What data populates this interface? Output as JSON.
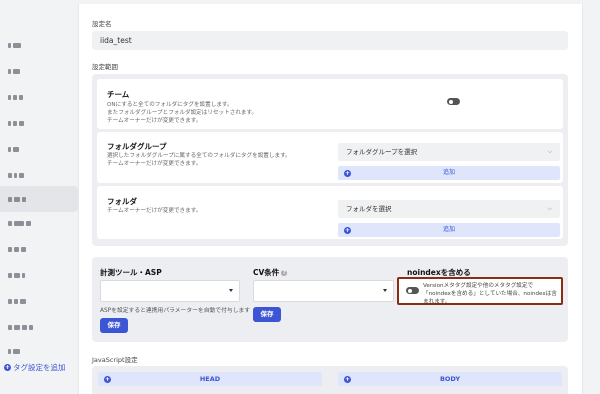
{
  "sidebar": {
    "add_label": "タグ設定を追加"
  },
  "form": {
    "name_label": "設定名",
    "name_value": "iida_test",
    "scope_label": "設定範囲",
    "team": {
      "title": "チーム",
      "desc": [
        "ONにすると全てのフォルダにタグを設置します。",
        "またフォルダグループとフォルダ設定はリセットされます。",
        "チームオーナーだけが変更できます。"
      ]
    },
    "folder_group": {
      "title": "フォルダグループ",
      "desc": [
        "選択したフォルダグループに属する全てのフォルダにタグを設置します。",
        "チームオーナーだけが変更できます。"
      ],
      "select_placeholder": "フォルダグループを選択",
      "add_label": "追加"
    },
    "folder": {
      "title": "フォルダ",
      "desc": [
        "チームオーナーだけが変更できます。"
      ],
      "select_placeholder": "フォルダを選択",
      "add_label": "追加"
    },
    "tool": {
      "title": "計測ツール・ASP",
      "note": "ASPを設定すると連携用パラメーターを自動で付与します",
      "save_label": "保存"
    },
    "cv": {
      "title": "CV条件",
      "help": "?",
      "save_label": "保存"
    },
    "noindex": {
      "title": "noindexを含める",
      "text": "Versionメタタグ設定や他のメタタグ設定で「noindexを含める」としていた場合、noindexは含まれます。"
    },
    "js": {
      "label": "JavaScript設定",
      "head_label": "HEAD",
      "body_label": "BODY"
    }
  }
}
